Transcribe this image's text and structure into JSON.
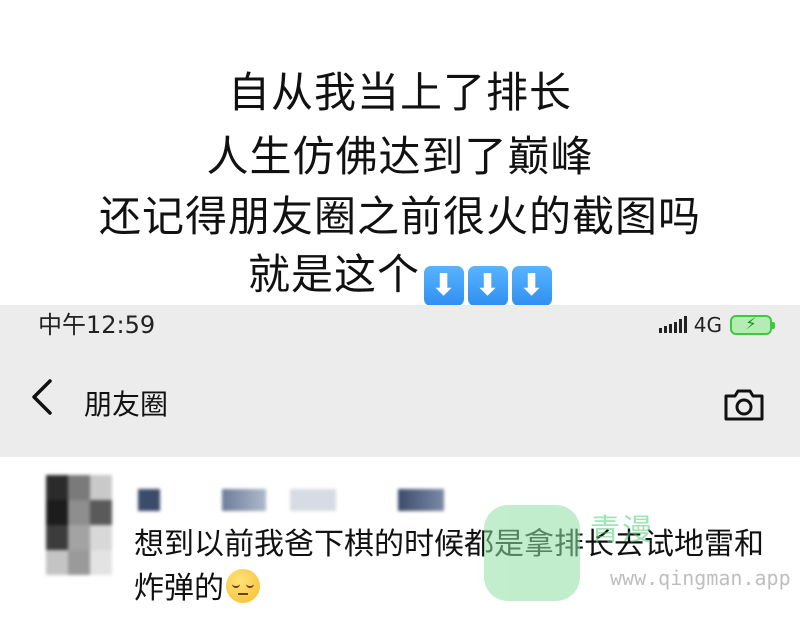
{
  "caption": {
    "line1": "自从我当上了排长",
    "line2": "人生仿佛达到了巅峰",
    "line3": "还记得朋友圈之前很火的截图吗",
    "line4": "就是这个",
    "arrow_icon": "⬇",
    "arrow_color": "#3d9af5"
  },
  "status_bar": {
    "time": "中午12:59",
    "network": "4G",
    "network_suffix": "ⁿ",
    "battery_icon": "battery-charging-icon",
    "battery_color": "#3ec83e"
  },
  "nav": {
    "title": "朋友圈",
    "back_icon": "chevron-left-icon",
    "camera_icon": "camera-icon"
  },
  "post": {
    "text_main": "想到以前我爸下棋的时候都是拿排长去试地雷和炸弹的",
    "emoji": "pensive-face-emoji"
  },
  "watermark": {
    "brand": "青漫",
    "url": "www.qingman.app"
  }
}
